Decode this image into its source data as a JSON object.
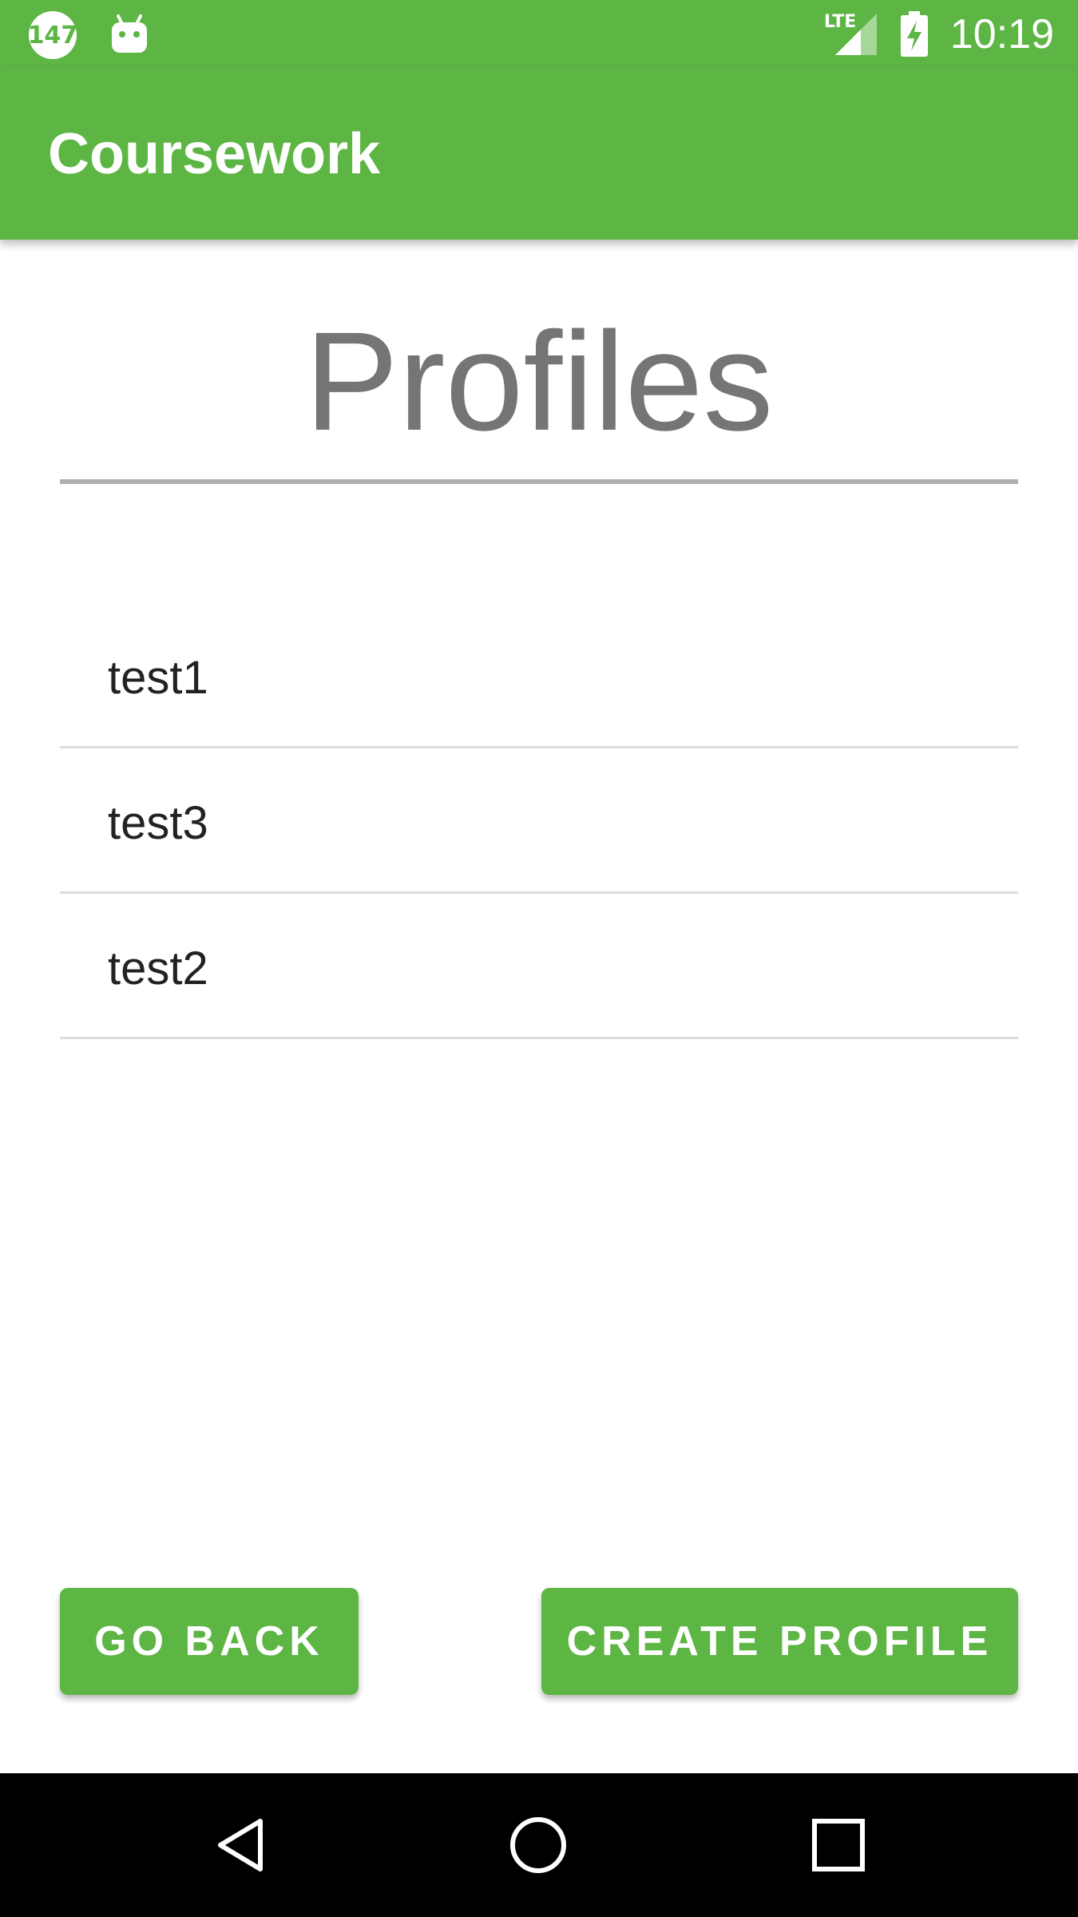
{
  "status_bar": {
    "notification_badge": "147",
    "network": "LTE",
    "time": "10:19"
  },
  "app_bar": {
    "title": "Coursework"
  },
  "page": {
    "heading": "Profiles"
  },
  "profiles": [
    "test1",
    "test3",
    "test2"
  ],
  "buttons": {
    "go_back": "GO BACK",
    "create_profile": "CREATE PROFILE"
  },
  "colors": {
    "primary": "#5db544",
    "heading_text": "#757575",
    "nav_bar": "#000000"
  },
  "icons": [
    "notification-badge-icon",
    "android-icon",
    "lte-signal-icon",
    "battery-charging-icon",
    "back-nav-icon",
    "home-nav-icon",
    "recents-nav-icon"
  ]
}
